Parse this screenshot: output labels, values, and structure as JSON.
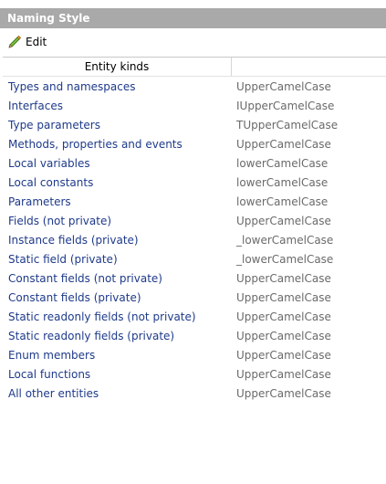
{
  "panel": {
    "title": "Naming Style"
  },
  "toolbar": {
    "edit_label": "Edit"
  },
  "table": {
    "header_kinds": "Entity kinds",
    "header_style": "",
    "rows": [
      {
        "kind": "Types and namespaces",
        "style": "UpperCamelCase"
      },
      {
        "kind": "Interfaces",
        "style": "IUpperCamelCase"
      },
      {
        "kind": "Type parameters",
        "style": "TUpperCamelCase"
      },
      {
        "kind": "Methods, properties and events",
        "style": "UpperCamelCase"
      },
      {
        "kind": "Local variables",
        "style": "lowerCamelCase"
      },
      {
        "kind": "Local constants",
        "style": "lowerCamelCase"
      },
      {
        "kind": "Parameters",
        "style": "lowerCamelCase"
      },
      {
        "kind": "Fields (not private)",
        "style": "UpperCamelCase"
      },
      {
        "kind": "Instance fields (private)",
        "style": "_lowerCamelCase"
      },
      {
        "kind": "Static field (private)",
        "style": "_lowerCamelCase"
      },
      {
        "kind": "Constant fields (not private)",
        "style": "UpperCamelCase"
      },
      {
        "kind": "Constant fields (private)",
        "style": "UpperCamelCase"
      },
      {
        "kind": "Static readonly fields (not private)",
        "style": "UpperCamelCase"
      },
      {
        "kind": "Static readonly fields (private)",
        "style": "UpperCamelCase"
      },
      {
        "kind": "Enum members",
        "style": "UpperCamelCase"
      },
      {
        "kind": "Local functions",
        "style": "UpperCamelCase"
      },
      {
        "kind": "All other entities",
        "style": "UpperCamelCase"
      }
    ]
  },
  "icons": {
    "edit": "pencil-icon"
  },
  "colors": {
    "title_bar": "#a9a9a9",
    "kind_text": "#1e3a8a",
    "style_text": "#6a6a6a"
  }
}
